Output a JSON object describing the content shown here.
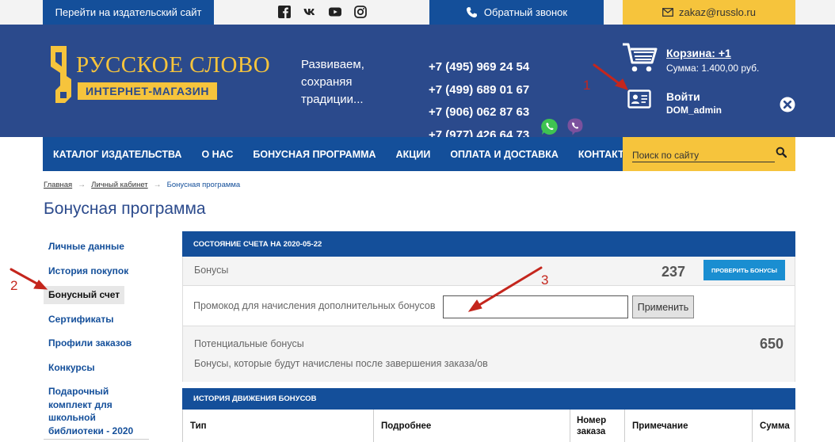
{
  "topbar": {
    "publisher_link": "Перейти на издательский сайт",
    "social_icons": [
      "facebook-icon",
      "vk-icon",
      "youtube-icon",
      "instagram-icon"
    ],
    "callback_label": "Обратный звонок",
    "email": "zakaz@russlo.ru"
  },
  "header": {
    "logo_top": "РУССКОЕ СЛОВО",
    "logo_bottom": "ИНТЕРНЕТ-МАГАЗИН",
    "slogan_1": "Развиваем,",
    "slogan_2": "сохраняя",
    "slogan_3": "традиции...",
    "phones": [
      "+7 (495) 969 24 54",
      "+7 (499) 689 01 67",
      "+7 (906) 062 87 63",
      "+7 (977) 426 64 73"
    ],
    "cart_title": "Корзина: +1",
    "cart_sum": "Сумма: 1.400,00 руб.",
    "login_title": "Войти",
    "login_user": "DOM_admin"
  },
  "nav": {
    "items": [
      "КАТАЛОГ ИЗДАТЕЛЬСТВА",
      "О НАС",
      "БОНУСНАЯ ПРОГРАММА",
      "АКЦИИ",
      "ОПЛАТА И ДОСТАВКА",
      "КОНТАКТЫ"
    ],
    "search_placeholder": "Поиск по сайту"
  },
  "breadcrumb": {
    "home": "Главная",
    "account": "Личный кабинет",
    "current": "Бонусная программа"
  },
  "page_title": "Бонусная программа",
  "sidebar": {
    "items": [
      "Личные данные",
      "История покупок",
      "Бонусный счет",
      "Сертификаты",
      "Профили заказов",
      "Конкурсы",
      "Подарочный комплект для школьной библиотеки - 2020"
    ],
    "active_index": 2
  },
  "account": {
    "state_header": "СОСТОЯНИЕ СЧЕТА НА 2020-05-22",
    "bonus_label": "Бонусы",
    "bonus_value": "237",
    "check_button": "ПРОВЕРИТЬ БОНУСЫ",
    "promo_label": "Промокод для начисления дополнительных бонусов",
    "promo_value": "",
    "apply_button": "Применить",
    "potential_label": "Потенциальные бонусы",
    "potential_value": "650",
    "potential_note": "Бонусы, которые будут начислены после завершения заказа/ов"
  },
  "history": {
    "header": "ИСТОРИЯ ДВИЖЕНИЯ БОНУСОВ",
    "columns": [
      "Тип",
      "Подробнее",
      "Номер заказа",
      "Примечание",
      "Сумма"
    ]
  },
  "annotations": [
    "1",
    "2",
    "3"
  ],
  "colors": {
    "brand_blue": "#144f9a",
    "header_blue": "#2b4a8c",
    "accent_yellow": "#f6c43c",
    "annotation_red": "#c4261d",
    "button_blue": "#1a8ed1"
  }
}
